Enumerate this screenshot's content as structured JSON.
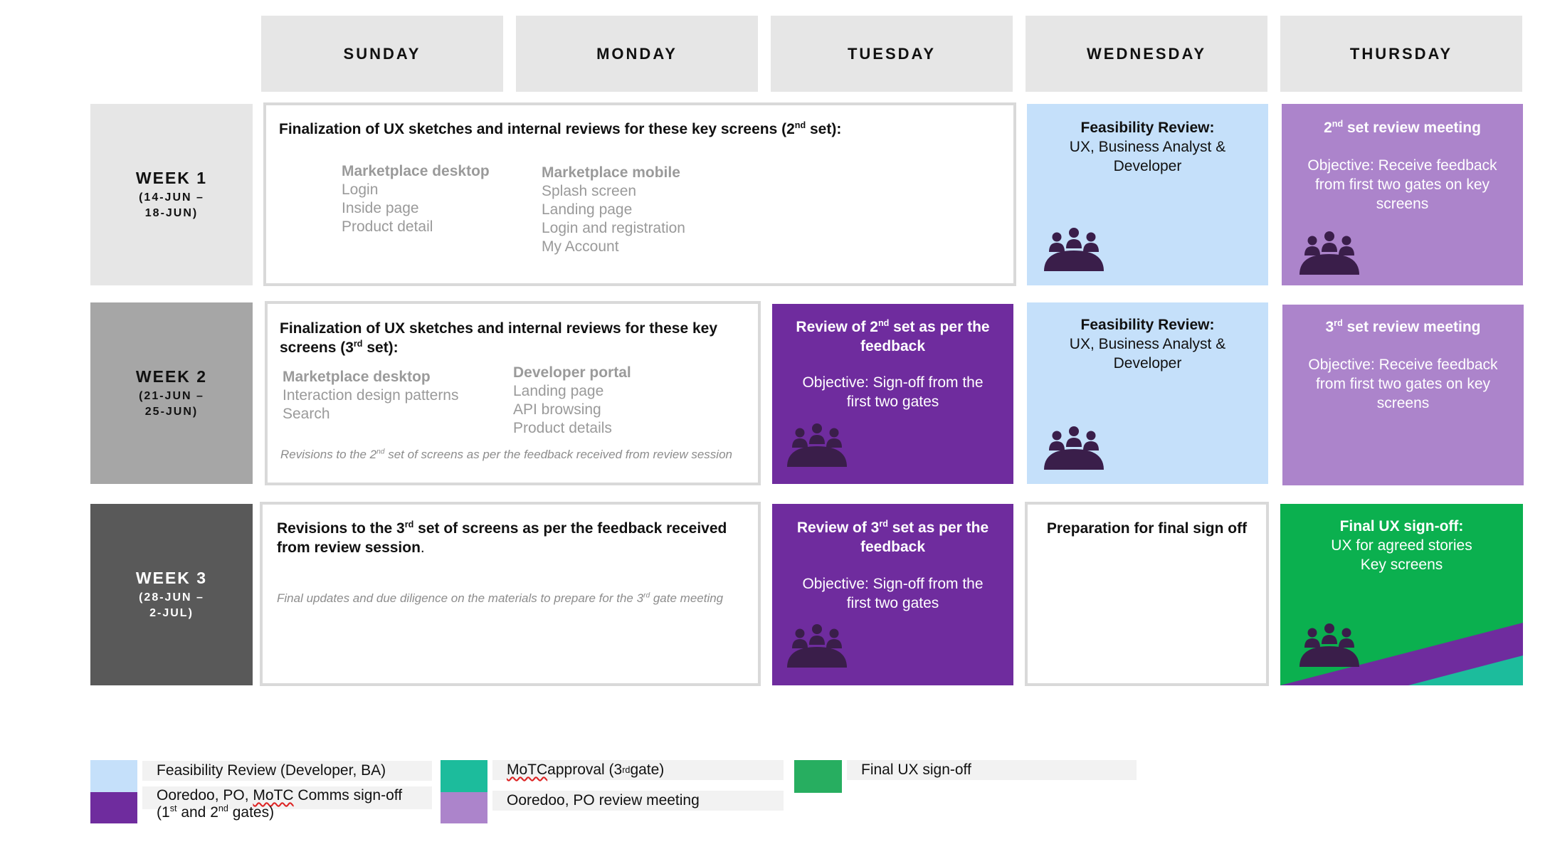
{
  "days": [
    "SUNDAY",
    "MONDAY",
    "TUESDAY",
    "WEDNESDAY",
    "THURSDAY"
  ],
  "weeks": [
    {
      "label": "WEEK 1",
      "dates_a": "(14-JUN –",
      "dates_b": "18-JUN)"
    },
    {
      "label": "WEEK 2",
      "dates_a": "(21-JUN –",
      "dates_b": "25-JUN)"
    },
    {
      "label": "WEEK 3",
      "dates_a": "(28-JUN –",
      "dates_b": "2-JUL)"
    }
  ],
  "w1_main": {
    "head_a": "Finalization of UX sketches and internal reviews for these key screens (2",
    "head_sup": "nd",
    "head_b": " set):",
    "col1_head": "Marketplace desktop",
    "col1_items": [
      "Login",
      "Inside page",
      "Product detail"
    ],
    "col2_head": "Marketplace mobile",
    "col2_items": [
      "Splash screen",
      "Landing page",
      "Login and registration",
      "My Account"
    ]
  },
  "w2_main": {
    "head_a": "Finalization of UX sketches and internal reviews for these key screens (3",
    "head_sup": "rd",
    "head_b": "  set):",
    "col1_head": "Marketplace desktop",
    "col1_items": [
      "Interaction design patterns",
      "Search"
    ],
    "col2_head": "Developer portal",
    "col2_items": [
      "Landing page",
      "API browsing",
      "Product details"
    ],
    "note_a": "Revisions to the 2",
    "note_sup": "nd",
    "note_b": " set of screens as per the feedback received from review session"
  },
  "w3_main": {
    "head_a": "Revisions to the 3",
    "head_sup": "rd",
    "head_b": " set of screens as per the feedback received from review session",
    "head_dot": ".",
    "note_a": "Final updates and due diligence on the materials to prepare for the 3",
    "note_sup": "rd",
    "note_b": " gate meeting"
  },
  "feasibility": {
    "title": "Feasibility Review:",
    "line1": "UX, Business Analyst &",
    "line2": "Developer"
  },
  "thu_w1": {
    "title_sup": "nd",
    "title_num": "2",
    "title_rest": " set review meeting",
    "obj1": "Objective: Receive feedback",
    "obj2": "from first two gates on key",
    "obj3": "screens"
  },
  "thu_w2": {
    "title_sup": "rd",
    "title_num": "3",
    "title_rest": " set review meeting",
    "obj1": "Objective: Receive feedback",
    "obj2": "from first two gates on key",
    "obj3": "screens"
  },
  "tue_w2": {
    "title_a": "Review of 2",
    "title_sup": "nd",
    "title_b": "  set as per the",
    "title_c": "feedback",
    "obj1": "Objective: Sign-off from the",
    "obj2": "first two gates"
  },
  "tue_w3": {
    "title_a": "Review of 3",
    "title_sup": "rd",
    "title_b": " set as per the",
    "title_c": "feedback",
    "obj1": "Objective: Sign-off from the",
    "obj2": "first two gates"
  },
  "wed_w3": {
    "title": "Preparation for final sign off"
  },
  "thu_w3": {
    "title": "Final UX sign-off:",
    "line1": "UX for agreed stories",
    "line2": "Key screens"
  },
  "legend": {
    "feasibility": "Feasibility Review (Developer, BA)",
    "signoff_a": "Ooredoo, PO, ",
    "signoff_motc": "MoTC",
    "signoff_b": " Comms sign-off",
    "signoff_c1": "(1",
    "signoff_sup1": "st",
    "signoff_c2": " and 2",
    "signoff_sup2": "nd",
    "signoff_c3": " gates)",
    "motc_a": "MoTC",
    "motc_b": " approval (3",
    "motc_sup": "rd",
    "motc_c": " gate)",
    "review": "Ooredoo, PO review meeting",
    "final": "Final UX sign-off"
  },
  "colors": {
    "light_blue": "#c5e0fa",
    "purple": "#6f2c9e",
    "lavender": "#ac84cb",
    "teal": "#1cbc9c",
    "green": "#0bb04f",
    "final_green_swatch": "#27ae60",
    "icon_dark": "#3a1e4a"
  },
  "icons": {
    "meeting": "people-group-icon"
  }
}
